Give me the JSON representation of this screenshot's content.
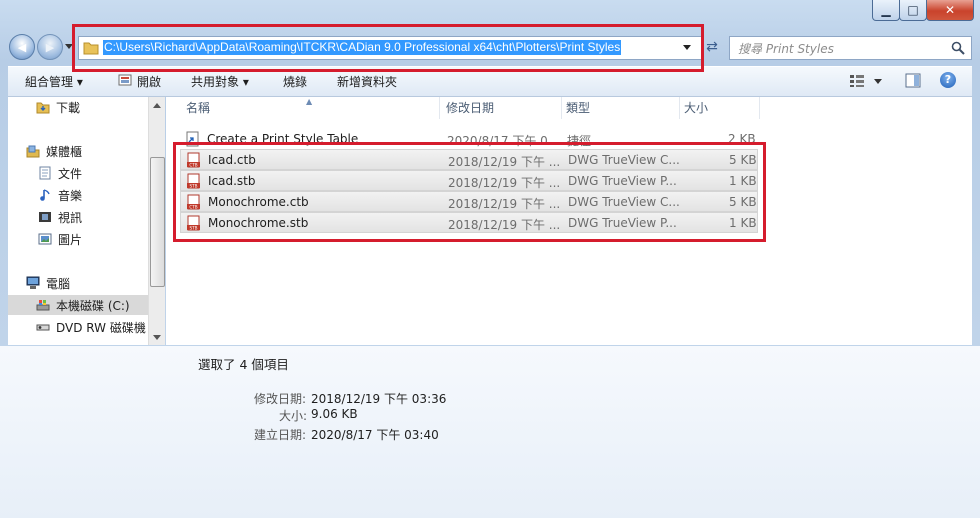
{
  "window": {
    "min_glyph": "▁",
    "max_glyph": "□",
    "close_glyph": "✕"
  },
  "nav": {
    "back_glyph": "◀",
    "forward_glyph": "▶",
    "address": "C:\\Users\\Richard\\AppData\\Roaming\\ITCKR\\CADian 9.0 Professional x64\\cht\\Plotters\\Print Styles",
    "search_placeholder": "搜尋 Print Styles"
  },
  "toolbar": {
    "organize": "組合管理 ▾",
    "open": "開啟",
    "share": "共用對象 ▾",
    "burn": "燒錄",
    "new_folder": "新增資料夾"
  },
  "sidebar": {
    "items": [
      {
        "label": "下載",
        "icon": "download-folder-icon"
      },
      {
        "label": "媒體櫃",
        "icon": "library-icon"
      },
      {
        "label": "文件",
        "icon": "documents-icon"
      },
      {
        "label": "音樂",
        "icon": "music-icon"
      },
      {
        "label": "視訊",
        "icon": "video-icon"
      },
      {
        "label": "圖片",
        "icon": "pictures-icon"
      },
      {
        "label": "電腦",
        "icon": "computer-icon"
      },
      {
        "label": "本機磁碟 (C:)",
        "icon": "local-disk-icon"
      },
      {
        "label": "DVD RW 磁碟機",
        "icon": "dvd-drive-icon"
      }
    ]
  },
  "columns": {
    "name": "名稱",
    "date": "修改日期",
    "type": "類型",
    "size": "大小"
  },
  "files": [
    {
      "name": "Create a Print Style Table",
      "date": "2020/8/17 下午 0...",
      "type": "捷徑",
      "size": "2 KB",
      "badge": ""
    },
    {
      "name": "Icad.ctb",
      "date": "2018/12/19 下午 ...",
      "type": "DWG TrueView C...",
      "size": "5 KB",
      "badge": "CTB"
    },
    {
      "name": "Icad.stb",
      "date": "2018/12/19 下午 ...",
      "type": "DWG TrueView P...",
      "size": "1 KB",
      "badge": "STB"
    },
    {
      "name": "Monochrome.ctb",
      "date": "2018/12/19 下午 ...",
      "type": "DWG TrueView C...",
      "size": "5 KB",
      "badge": "CTB"
    },
    {
      "name": "Monochrome.stb",
      "date": "2018/12/19 下午 ...",
      "type": "DWG TrueView P...",
      "size": "1 KB",
      "badge": "STB"
    }
  ],
  "details": {
    "selected": "選取了 4 個項目",
    "modified_label": "修改日期:",
    "modified_value": "2018/12/19 下午 03:36",
    "size_label": "大小:",
    "size_value": "9.06 KB",
    "created_label": "建立日期:",
    "created_value": "2020/8/17 下午 03:40"
  },
  "colors": {
    "highlight": "#d51c2d",
    "selection": "#3399ff"
  }
}
